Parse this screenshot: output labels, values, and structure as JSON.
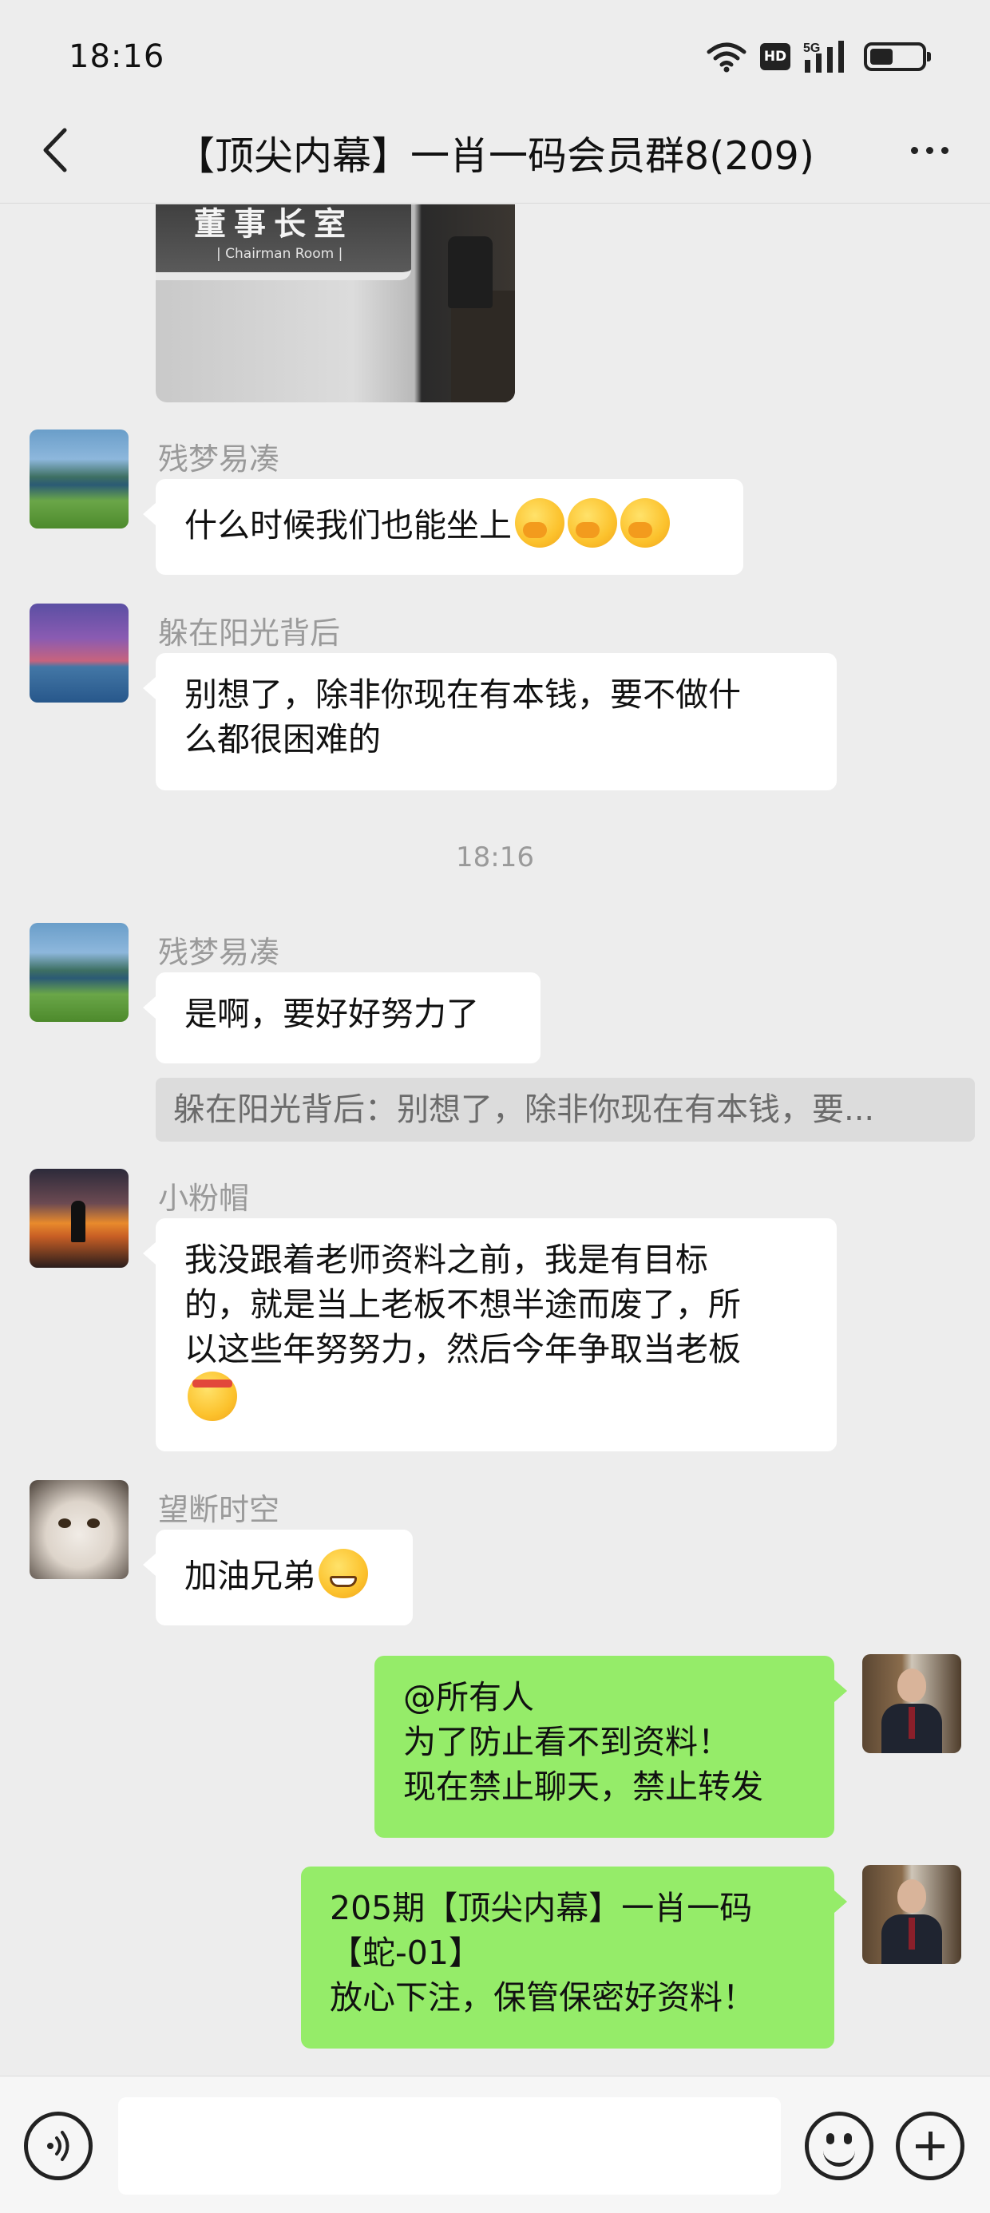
{
  "status_bar": {
    "time": "18:16",
    "hd_label": "HD",
    "network_label": "5G",
    "battery_level": 0.45,
    "icons": [
      "wifi-icon",
      "hd-icon",
      "signal-5g-icon",
      "battery-icon"
    ]
  },
  "nav": {
    "title": "【顶尖内幕】一肖一码会员群8(209)",
    "back_icon": "chevron-left-icon",
    "more_icon": "more-dots-icon"
  },
  "image_message": {
    "sign_text": "董事长室",
    "sign_subtext": "| Chairman Room |"
  },
  "messages": [
    {
      "sender": "残梦易凑",
      "lines": [
        "什么时候我们也能坐上"
      ],
      "emoji": [
        "thinking-emoji",
        "thinking-emoji",
        "thinking-emoji"
      ]
    },
    {
      "sender": "躲在阳光背后",
      "lines": [
        "别想了，除非你现在有本钱，要不做什",
        "么都很困难的"
      ]
    },
    {
      "sender": "残梦易凑",
      "lines": [
        "是啊，要好好努力了"
      ]
    },
    {
      "sender": "小粉帽",
      "lines": [
        "我没跟着老师资料之前，我是有目标",
        "的，就是当上老板不想半途而废了，所",
        "以这些年努努力，然后今年争取当老板"
      ],
      "emoji": [
        "determined-emoji"
      ]
    },
    {
      "sender": "望断时空",
      "lines": [
        "加油兄弟"
      ],
      "emoji": [
        "grin-emoji"
      ]
    }
  ],
  "timestamp": "18:16",
  "quote": "躲在阳光背后：别想了，除非你现在有本钱，要...",
  "own_messages": [
    {
      "lines": [
        "@所有人",
        "为了防止看不到资料！",
        "现在禁止聊天，禁止转发"
      ]
    },
    {
      "lines": [
        "205期【顶尖内幕】一肖一码",
        "【蛇-01】",
        "放心下注，保管保密好资料！"
      ]
    }
  ],
  "input_bar": {
    "placeholder": "",
    "voice_icon": "voice-icon",
    "emoji_icon": "emoji-icon",
    "plus_icon": "plus-icon"
  },
  "colors": {
    "background": "#ededed",
    "own_bubble": "#95ec69",
    "other_bubble": "#ffffff",
    "sender_name": "#9a9a9a"
  }
}
